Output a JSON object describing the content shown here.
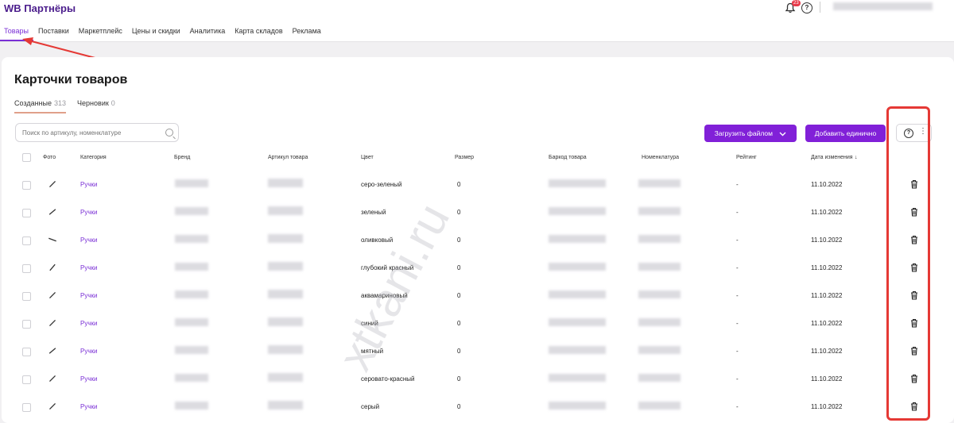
{
  "header": {
    "logo": "WB Партнёры",
    "notification_count": "23",
    "nav": [
      "Товары",
      "Поставки",
      "Маркетплейс",
      "Цены и скидки",
      "Аналитика",
      "Карта складов",
      "Реклама"
    ]
  },
  "page": {
    "title": "Карточки товаров",
    "tabs": [
      {
        "label": "Созданные",
        "count": "313"
      },
      {
        "label": "Черновик",
        "count": "0"
      }
    ],
    "search_placeholder": "Поиск по артикулу, номенклатуре",
    "upload_button": "Загрузить файлом",
    "add_button": "Добавить единично",
    "watermark": "xtkani.ru"
  },
  "table": {
    "columns": [
      "Фото",
      "Категория",
      "Бренд",
      "Артикул товара",
      "Цвет",
      "Размер",
      "Баркод товара",
      "Номенклатура",
      "Рейтинг",
      "Дата изменения"
    ],
    "rows": [
      {
        "category": "Ручки",
        "color": "серо-зеленый",
        "size": "0",
        "rating": "-",
        "date": "11.10.2022"
      },
      {
        "category": "Ручки",
        "color": "зеленый",
        "size": "0",
        "rating": "-",
        "date": "11.10.2022"
      },
      {
        "category": "Ручки",
        "color": "оливковый",
        "size": "0",
        "rating": "-",
        "date": "11.10.2022"
      },
      {
        "category": "Ручки",
        "color": "глубокий красный",
        "size": "0",
        "rating": "-",
        "date": "11.10.2022"
      },
      {
        "category": "Ручки",
        "color": "аквамариновый",
        "size": "0",
        "rating": "-",
        "date": "11.10.2022"
      },
      {
        "category": "Ручки",
        "color": "синий",
        "size": "0",
        "rating": "-",
        "date": "11.10.2022"
      },
      {
        "category": "Ручки",
        "color": "мятный",
        "size": "0",
        "rating": "-",
        "date": "11.10.2022"
      },
      {
        "category": "Ручки",
        "color": "серовато-красный",
        "size": "0",
        "rating": "-",
        "date": "11.10.2022"
      },
      {
        "category": "Ручки",
        "color": "серый",
        "size": "0",
        "rating": "-",
        "date": "11.10.2022"
      }
    ]
  },
  "colors": {
    "accent": "#8120d8",
    "annotation": "#e53935"
  }
}
